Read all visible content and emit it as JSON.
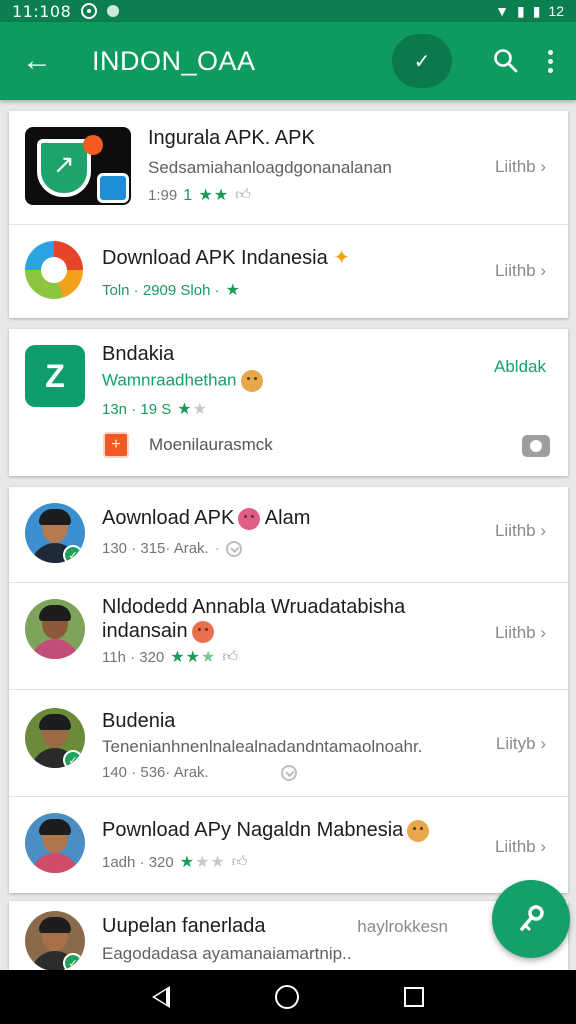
{
  "status_bar": {
    "time": "11:108",
    "battery": "12"
  },
  "app_bar": {
    "title": "INDON_OAA",
    "back_icon": "arrow-back-icon",
    "check_icon": "check-icon",
    "search_icon": "search-icon",
    "menu_icon": "more-vert-icon"
  },
  "colors": {
    "primary": "#0f9a5f",
    "primary_dark": "#0b7f4f",
    "accent": "#15a06a",
    "star": "#1b9a5c"
  },
  "list": [
    {
      "name": "Ingurala APK. APK",
      "desc": "Sedsamiahanloagdgonanalanan",
      "meta": "1:99",
      "rating": "1",
      "stars_on": 2,
      "stars_off": 0,
      "action": "Liithb",
      "icon": "shield-app-icon"
    },
    {
      "name": "Download APK Indanesia",
      "desc": "",
      "meta": "Toln · 2909 Sloh ·",
      "rating": "",
      "stars_on": 1,
      "stars_off": 0,
      "action": "Liithb",
      "icon": "compass-app-icon"
    },
    {
      "name": "Bndakia",
      "desc": "Wamnraadhethan",
      "meta": "13n · 19 S",
      "rating": "",
      "stars_on": 1,
      "stars_off": 1,
      "action": "Abldak",
      "icon": "green-app-icon",
      "sub_label": "Moenilaurasmck"
    },
    {
      "name": "Aownload APK",
      "name_suffix": "Alam",
      "desc": "",
      "meta": "130 · 315· Arak.",
      "action": "Liithb",
      "icon": "avatar-man-1"
    },
    {
      "name": "Nldodedd Annabla Wruadatabisha",
      "name2": "indansain",
      "desc": "",
      "meta": "11h · 320",
      "stars_on": 2,
      "stars_off": 1,
      "action": "Liithb",
      "icon": "avatar-woman"
    },
    {
      "name": "Budenia",
      "desc": "Tenenianhnenlnalealnadandntamaolnoahr.",
      "meta": "140 · 536· Arak.",
      "action": "Liityb",
      "icon": "avatar-man-2"
    },
    {
      "name": "Pownload APy Nagaldn Mabnesia",
      "desc": "",
      "meta": "1adh · 320",
      "stars_on": 1,
      "stars_off": 2,
      "action": "Liithb",
      "icon": "avatar-man-3"
    },
    {
      "name": "Uupelan fanerlada",
      "desc": "Eagodadasa ayamanaiamartnip..",
      "meta": "",
      "action": "haylrokkesn",
      "icon": "avatar-man-4"
    }
  ],
  "fab": {
    "icon": "share-key-icon"
  },
  "nav": {
    "back": "nav-back-icon",
    "home": "nav-home-icon",
    "recents": "nav-recents-icon"
  }
}
